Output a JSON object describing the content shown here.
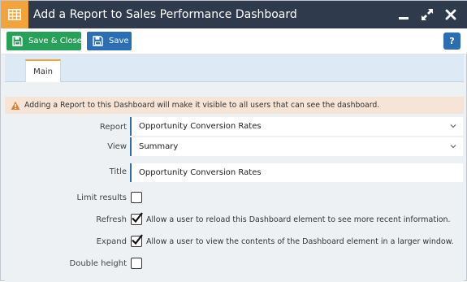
{
  "window": {
    "title": "Add a Report to Sales Performance Dashboard",
    "icon": "table-grid-icon"
  },
  "colors": {
    "titlebar": "#2f3b4c",
    "title_icon_bg": "#f2a33a",
    "save_close_green": "#27a05a",
    "save_blue": "#2b6eb3",
    "warning_bg": "#f6e4d6",
    "warning_icon": "#e0802c"
  },
  "toolbar": {
    "save_close_label": "Save & Close",
    "save_label": "Save",
    "help_label": "?"
  },
  "tabs": [
    {
      "label": "Main",
      "active": true
    }
  ],
  "warning": {
    "text": "Adding a Report to this Dashboard will make it visible to all users that can see the dashboard."
  },
  "form": {
    "report": {
      "label": "Report",
      "value": "Opportunity Conversion Rates"
    },
    "view": {
      "label": "View",
      "value": "Summary"
    },
    "title": {
      "label": "Title",
      "value": "Opportunity Conversion Rates"
    },
    "limit_results": {
      "label": "Limit results",
      "checked": false
    },
    "refresh": {
      "label": "Refresh",
      "checked": true,
      "description": "Allow a user to reload this Dashboard element to see more recent information."
    },
    "expand": {
      "label": "Expand",
      "checked": true,
      "description": "Allow a user to view the contents of the Dashboard element in a larger window."
    },
    "double_height": {
      "label": "Double height",
      "checked": false
    }
  }
}
